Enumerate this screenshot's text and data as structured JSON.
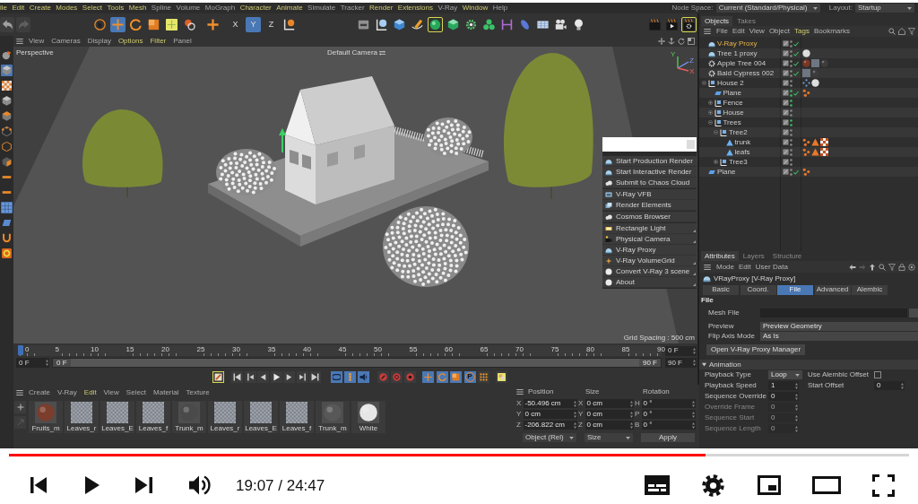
{
  "menu_bar": {
    "items": [
      {
        "label": "ile",
        "highlighted": true
      },
      {
        "label": "Edit",
        "highlighted": true
      },
      {
        "label": "Create",
        "highlighted": true
      },
      {
        "label": "Modes",
        "highlighted": true
      },
      {
        "label": "Select",
        "highlighted": true
      },
      {
        "label": "Tools",
        "highlighted": true
      },
      {
        "label": "Mesh",
        "highlighted": true
      },
      {
        "label": "Spline",
        "highlighted": false
      },
      {
        "label": "Volume",
        "highlighted": false
      },
      {
        "label": "MoGraph",
        "highlighted": false
      },
      {
        "label": "Character",
        "highlighted": true
      },
      {
        "label": "Animate",
        "highlighted": true
      },
      {
        "label": "Simulate",
        "highlighted": false
      },
      {
        "label": "Tracker",
        "highlighted": false
      },
      {
        "label": "Render",
        "highlighted": true
      },
      {
        "label": "Extensions",
        "highlighted": true
      },
      {
        "label": "V-Ray",
        "highlighted": false
      },
      {
        "label": "Window",
        "highlighted": true
      },
      {
        "label": "Help",
        "highlighted": false
      }
    ],
    "node_space": {
      "label": "Node Space:",
      "value": "Current (Standard/Physical)"
    },
    "layout": {
      "label": "Layout:",
      "value": "Startup"
    }
  },
  "toolbar": {
    "groups": [
      [
        {
          "kind": "undo",
          "selected": false,
          "highlighted": false
        },
        {
          "kind": "redo",
          "selected": false,
          "highlighted": false
        }
      ],
      [
        {
          "kind": "select",
          "selected": false,
          "highlighted": false
        },
        {
          "kind": "move",
          "selected": true,
          "highlighted": false
        },
        {
          "kind": "rotate",
          "selected": false,
          "highlighted": false
        },
        {
          "kind": "scale",
          "selected": false,
          "highlighted": false
        },
        {
          "kind": "live",
          "selected": false,
          "highlighted": false
        },
        {
          "kind": "paint",
          "selected": false,
          "highlighted": false
        }
      ],
      [
        {
          "kind": "plus",
          "selected": false,
          "highlighted": false
        }
      ],
      [
        {
          "kind": "axis",
          "label": "X",
          "selected": false,
          "highlighted": false
        },
        {
          "kind": "axis",
          "label": "Y",
          "selected": true,
          "highlighted": false
        },
        {
          "kind": "axis",
          "label": "Z",
          "selected": false,
          "highlighted": false
        },
        {
          "kind": "coord",
          "selected": false,
          "highlighted": false
        }
      ],
      [
        {
          "kind": "tray",
          "selected": false,
          "highlighted": false
        },
        {
          "kind": "nullsphere",
          "selected": false,
          "highlighted": false
        },
        {
          "kind": "cube",
          "selected": false,
          "highlighted": false
        },
        {
          "kind": "pen",
          "selected": false,
          "highlighted": false
        },
        {
          "kind": "gsphere",
          "selected": false,
          "highlighted": true
        },
        {
          "kind": "gbox",
          "selected": false,
          "highlighted": false
        },
        {
          "kind": "gear",
          "selected": false,
          "highlighted": false
        },
        {
          "kind": "atoms",
          "selected": false,
          "highlighted": false
        },
        {
          "kind": "bracket",
          "selected": false,
          "highlighted": false
        },
        {
          "kind": "capsule",
          "selected": false,
          "highlighted": false
        },
        {
          "kind": "floor",
          "selected": false,
          "highlighted": false
        },
        {
          "kind": "camera",
          "selected": false,
          "highlighted": false
        },
        {
          "kind": "bulb",
          "selected": false,
          "highlighted": false
        }
      ],
      [
        {
          "kind": "clapper",
          "selected": false,
          "highlighted": false
        },
        {
          "kind": "clapperplay",
          "selected": false,
          "highlighted": false
        },
        {
          "kind": "clappergear",
          "selected": false,
          "highlighted": true
        }
      ]
    ]
  },
  "side_toolbar": [
    {
      "kind": "viewsphere",
      "selected": false
    },
    {
      "kind": "scube",
      "selected": true
    },
    {
      "kind": "checker",
      "selected": false
    },
    {
      "kind": "scube",
      "selected": false
    },
    {
      "kind": "ocube",
      "selected": false
    },
    {
      "kind": "points",
      "selected": false
    },
    {
      "kind": "edges",
      "selected": false
    },
    {
      "kind": "faces",
      "selected": false
    },
    {
      "kind": "bar",
      "selected": false
    },
    {
      "kind": "bar",
      "selected": false
    },
    {
      "kind": "grid",
      "selected": true
    },
    {
      "kind": "tile",
      "selected": false
    },
    {
      "kind": "magnet",
      "selected": false
    },
    {
      "kind": "ring",
      "selected": false
    }
  ],
  "viewport": {
    "menu": [
      {
        "label": "View",
        "highlighted": false
      },
      {
        "label": "Cameras",
        "highlighted": false
      },
      {
        "label": "Display",
        "highlighted": false
      },
      {
        "label": "Options",
        "highlighted": true
      },
      {
        "label": "Filter",
        "highlighted": true
      },
      {
        "label": "Panel",
        "highlighted": false
      }
    ],
    "view_name": "Perspective",
    "camera": "Default Camera",
    "axis_labels": [
      "Y",
      "Z",
      "X"
    ],
    "grid_spacing": "Grid Spacing : 500 cm"
  },
  "popup": {
    "groups": [
      [
        {
          "label": "Start Production Render",
          "kind": "dome",
          "submenu": false
        },
        {
          "label": "Start Interactive Render",
          "kind": "dome",
          "submenu": false
        },
        {
          "label": "Submit to Chaos Cloud",
          "kind": "cloud",
          "submenu": false
        }
      ],
      [
        {
          "label": "V-Ray VFB",
          "kind": "frame",
          "submenu": false
        },
        {
          "label": "Render Elements",
          "kind": "layers",
          "submenu": false
        }
      ],
      [
        {
          "label": "Cosmos Browser",
          "kind": "cloud",
          "submenu": false
        }
      ],
      [
        {
          "label": "Rectangle Light",
          "kind": "lamp",
          "submenu": true
        },
        {
          "label": "Physical Camera",
          "kind": "moviecam",
          "submenu": true
        },
        {
          "label": "V-Ray Proxy",
          "kind": "dome",
          "submenu": false
        },
        {
          "label": "V-Ray VolumeGrid",
          "kind": "spark",
          "submenu": true
        },
        {
          "label": "Convert V-Ray 3 scene",
          "kind": "disc",
          "submenu": true
        },
        {
          "label": "About",
          "kind": "disc",
          "submenu": true
        }
      ]
    ]
  },
  "timeline": {
    "ticks": [
      "0",
      "5",
      "10",
      "15",
      "20",
      "25",
      "30",
      "35",
      "40",
      "45",
      "50",
      "55",
      "60",
      "65",
      "70",
      "75",
      "80",
      "85",
      "90"
    ],
    "level": 0,
    "current_frame": "0 F",
    "start_frame": "0 F",
    "range": {
      "start": "0 F",
      "end": "90 F",
      "level": 1
    },
    "end_frame": "90 F"
  },
  "transport": {
    "groups": [
      [
        {
          "kind": "keyframe",
          "selected": false,
          "highlighted": true
        }
      ],
      [
        {
          "kind": "first",
          "selected": false,
          "highlighted": false
        },
        {
          "kind": "prevkey",
          "selected": false,
          "highlighted": false
        },
        {
          "kind": "prevframe",
          "selected": false,
          "highlighted": false
        },
        {
          "kind": "play",
          "selected": false,
          "highlighted": false
        },
        {
          "kind": "nextframe",
          "selected": false,
          "highlighted": false
        },
        {
          "kind": "nextkey",
          "selected": false,
          "highlighted": false
        },
        {
          "kind": "last",
          "selected": false,
          "highlighted": false
        }
      ],
      [
        {
          "kind": "loop",
          "selected": true,
          "highlighted": false
        },
        {
          "kind": "stack",
          "selected": true,
          "highlighted": false
        },
        {
          "kind": "sound",
          "selected": true,
          "highlighted": false
        }
      ],
      [
        {
          "kind": "record",
          "selected": false,
          "highlighted": false
        },
        {
          "kind": "autokey",
          "selected": false,
          "highlighted": false
        },
        {
          "kind": "recdot",
          "selected": false,
          "highlighted": false
        }
      ],
      [
        {
          "kind": "move",
          "selected": true,
          "highlighted": false
        },
        {
          "kind": "rotate",
          "selected": true,
          "highlighted": false
        },
        {
          "kind": "scale",
          "selected": true,
          "highlighted": false
        },
        {
          "kind": "param",
          "label": "P",
          "selected": true,
          "highlighted": false
        },
        {
          "kind": "dotgrid",
          "selected": false,
          "highlighted": false
        }
      ],
      [
        {
          "kind": "keytool",
          "selected": false,
          "highlighted": false
        }
      ]
    ]
  },
  "materials": {
    "menu": [
      {
        "label": "Create",
        "highlighted": false
      },
      {
        "label": "V-Ray",
        "highlighted": false
      },
      {
        "label": "Edit",
        "highlighted": true
      },
      {
        "label": "View",
        "highlighted": false
      },
      {
        "label": "Select",
        "highlighted": false
      },
      {
        "label": "Material",
        "highlighted": false
      },
      {
        "label": "Texture",
        "highlighted": false
      }
    ],
    "items": [
      {
        "name": "Fruits_m",
        "kind": "sphere",
        "color": "#7b3d2c"
      },
      {
        "name": "Leaves_r",
        "kind": "checker"
      },
      {
        "name": "Leaves_E",
        "kind": "checker"
      },
      {
        "name": "Leaves_f",
        "kind": "checker"
      },
      {
        "name": "Trunk_m",
        "kind": "sphere",
        "color": "#4a4a4a"
      },
      {
        "name": "Leaves_r",
        "kind": "checker"
      },
      {
        "name": "Leaves_E",
        "kind": "checker"
      },
      {
        "name": "Leaves_f",
        "kind": "checker"
      },
      {
        "name": "Trunk_m",
        "kind": "sphere",
        "color": "#585858"
      },
      {
        "name": "White",
        "kind": "sphere",
        "color": "#e6e6e6"
      }
    ]
  },
  "coordinates": {
    "headers": [
      "Position",
      "Size",
      "Rotation"
    ],
    "rows": [
      [
        {
          "axis": "X",
          "value": "-50.496 cm"
        },
        {
          "axis": "X",
          "value": "0 cm"
        },
        {
          "axis": "H",
          "value": "0 °"
        }
      ],
      [
        {
          "axis": "Y",
          "value": "0 cm"
        },
        {
          "axis": "Y",
          "value": "0 cm"
        },
        {
          "axis": "P",
          "value": "0 °"
        }
      ],
      [
        {
          "axis": "Z",
          "value": "-206.822 cm"
        },
        {
          "axis": "Z",
          "value": "0 cm"
        },
        {
          "axis": "B",
          "value": "0 °"
        }
      ]
    ],
    "mode": "Object (Rel)",
    "size_mode": "Size",
    "apply": "Apply"
  },
  "objects": {
    "tabs": [
      {
        "label": "Objects",
        "selected": true
      },
      {
        "label": "Takes",
        "selected": false
      }
    ],
    "menu": [
      {
        "label": "File",
        "highlighted": false
      },
      {
        "label": "Edit",
        "highlighted": false
      },
      {
        "label": "View",
        "highlighted": false
      },
      {
        "label": "Object",
        "highlighted": false
      },
      {
        "label": "Tags",
        "highlighted": true
      },
      {
        "label": "Bookmarks",
        "highlighted": false
      }
    ],
    "tree": [
      {
        "name": "V-Ray Proxy",
        "kind": "proxy",
        "selected": true,
        "visible": false,
        "enabled": true
      },
      {
        "name": "Tree 1 proxy",
        "kind": "proxy",
        "selected": false,
        "visible": false,
        "enabled": true,
        "tags": [
          {
            "kind": "sphere",
            "color": "#dcdcdc"
          }
        ]
      },
      {
        "name": "Apple Tree 004",
        "kind": "tree",
        "selected": false,
        "visible": false,
        "enabled": true,
        "tags": [
          {
            "kind": "sphere",
            "color": "#7a3526"
          },
          {
            "kind": "swatch",
            "color": "#6e7682"
          },
          {
            "kind": "sphere",
            "color": "#3c3c3c"
          }
        ]
      },
      {
        "name": "Bald Cypress 002",
        "kind": "tree",
        "selected": false,
        "visible": false,
        "enabled": true,
        "tags": [
          {
            "kind": "swatch",
            "color": "#6e7682"
          },
          {
            "kind": "sphere",
            "color": "#3c3c3c"
          }
        ]
      },
      {
        "name": "House 2",
        "kind": "null",
        "selected": false,
        "visible": false,
        "enabled": false,
        "expanded": true,
        "tags": [
          {
            "kind": "dots"
          },
          {
            "kind": "sphere",
            "color": "#dcdcdc"
          }
        ],
        "children": [
          {
            "name": "Plane",
            "kind": "plane",
            "selected": false,
            "visible": true,
            "enabled": true,
            "tags": [
              {
                "kind": "points"
              }
            ]
          },
          {
            "name": "Fence",
            "kind": "null",
            "selected": false,
            "visible": true,
            "enabled": false,
            "expanded": false
          },
          {
            "name": "House",
            "kind": "null",
            "selected": false,
            "visible": false,
            "enabled": false,
            "expanded": false
          },
          {
            "name": "Trees",
            "kind": "null",
            "selected": false,
            "visible": true,
            "enabled": false,
            "expanded": true,
            "children": [
              {
                "name": "Tree2",
                "kind": "null",
                "selected": false,
                "visible": false,
                "enabled": false,
                "expanded": true,
                "children": [
                  {
                    "name": "trunk",
                    "kind": "polygon",
                    "selected": false,
                    "visible": false,
                    "enabled": false,
                    "tags": [
                      {
                        "kind": "points"
                      },
                      {
                        "kind": "cone"
                      },
                      {
                        "kind": "checker"
                      }
                    ]
                  },
                  {
                    "name": "leafs",
                    "kind": "polygon",
                    "selected": false,
                    "visible": false,
                    "enabled": false,
                    "tags": [
                      {
                        "kind": "points"
                      },
                      {
                        "kind": "cone"
                      },
                      {
                        "kind": "checker"
                      }
                    ]
                  }
                ]
              },
              {
                "name": "Tree3",
                "kind": "null",
                "selected": false,
                "visible": false,
                "enabled": false,
                "expanded": false
              }
            ]
          }
        ]
      },
      {
        "name": "Plane",
        "kind": "plane",
        "selected": false,
        "visible": false,
        "enabled": true,
        "tags": [
          {
            "kind": "points"
          }
        ]
      }
    ]
  },
  "attributes": {
    "tabs": [
      {
        "label": "Attributes",
        "selected": true
      },
      {
        "label": "Layers",
        "selected": false
      },
      {
        "label": "Structure",
        "selected": false
      }
    ],
    "menu": [
      "Mode",
      "Edit",
      "User Data"
    ],
    "object": "VRayProxy [V-Ray Proxy]",
    "subtabs": [
      {
        "label": "Basic",
        "selected": false
      },
      {
        "label": "Coord.",
        "selected": false
      },
      {
        "label": "File",
        "selected": true
      },
      {
        "label": "Advanced",
        "selected": false
      },
      {
        "label": "Alembic",
        "selected": false
      }
    ],
    "section": "File",
    "mesh_file": "Mesh File",
    "preview": {
      "label": "Preview",
      "value": "Preview Geometry"
    },
    "flip_axis": {
      "label": "Flip Axis Mode",
      "value": "As Is"
    },
    "manager_button": "Open V-Ray Proxy Manager",
    "animation": {
      "title": "Animation",
      "expanded": true,
      "fields": [
        {
          "label": "Playback Type",
          "kind": "dropdown",
          "value": "Loop",
          "disabled": false
        },
        {
          "label": "Playback Speed",
          "kind": "number",
          "value": "1",
          "disabled": false
        },
        {
          "label": "Sequence Override",
          "kind": "number",
          "value": "0",
          "disabled": false
        },
        {
          "label": "Override Frame",
          "kind": "number",
          "value": "0",
          "disabled": true
        },
        {
          "label": "Sequence Start",
          "kind": "number",
          "value": "0",
          "disabled": true
        },
        {
          "label": "Sequence Length",
          "kind": "number",
          "value": "0",
          "disabled": true
        }
      ],
      "side_fields": [
        {
          "label": "Use Alembic Offset",
          "kind": "checkbox",
          "checked": false
        },
        {
          "label": "Start Offset",
          "kind": "number",
          "value": "0"
        }
      ]
    }
  },
  "player": {
    "level": 0.774,
    "time": "19:07 / 24:47",
    "playing": false
  }
}
